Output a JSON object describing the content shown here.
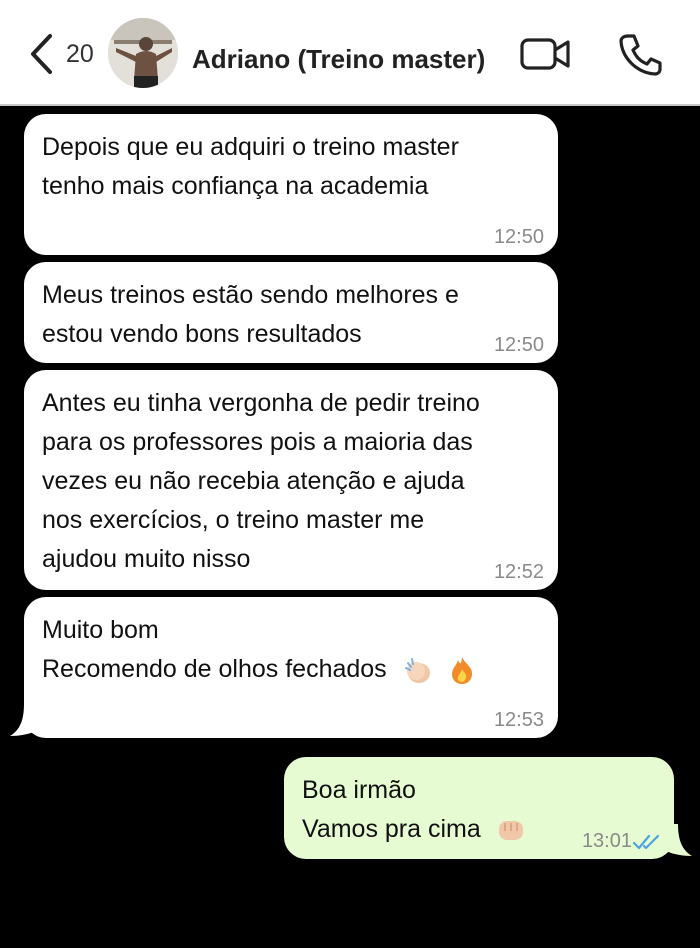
{
  "header": {
    "back_count": "20",
    "contact_name": "Adriano (Treino master)",
    "icons": {
      "back": "chevron-left-icon",
      "video": "video-camera-icon",
      "call": "phone-icon"
    }
  },
  "messages": [
    {
      "direction": "incoming",
      "lines": [
        "Depois que eu adquiri o treino master",
        "tenho mais confiança na academia"
      ],
      "time": "12:50"
    },
    {
      "direction": "incoming",
      "lines": [
        "Meus treinos estão sendo melhores e",
        "estou vendo bons resultados"
      ],
      "time": "12:50"
    },
    {
      "direction": "incoming",
      "lines": [
        "Antes eu tinha vergonha de pedir treino",
        "para os professores pois a maioria das",
        "vezes eu não recebia atenção e ajuda",
        "nos exercícios, o treino master me",
        "ajudou muito nisso"
      ],
      "time": "12:52"
    },
    {
      "direction": "incoming",
      "lines": [
        "Muito bom",
        "Recomendo de olhos fechados"
      ],
      "emojis": [
        "clapping-hands-emoji",
        "fire-emoji"
      ],
      "time": "12:53"
    },
    {
      "direction": "outgoing",
      "lines": [
        "Boa irmão",
        "Vamos pra cima"
      ],
      "emojis": [
        "fist-bump-emoji"
      ],
      "time": "13:01",
      "status": "read-double-check"
    }
  ],
  "colors": {
    "incoming_bubble": "#ffffff",
    "outgoing_bubble": "#e6fbd2",
    "read_ticks": "#4fa3e0",
    "background": "#000000"
  }
}
